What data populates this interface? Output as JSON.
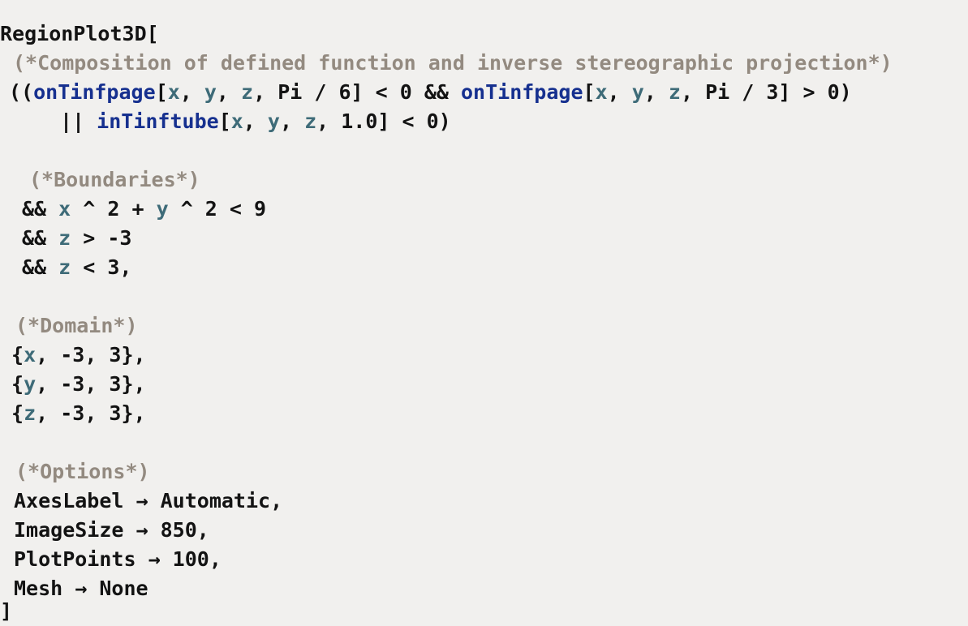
{
  "document": {
    "kind": "wolfram-language-code-listing",
    "background_color": "#f1f0ee",
    "colors": {
      "background": "#f1f0ee",
      "symbol": "#131313",
      "user_function": "#16308f",
      "local_variable": "#3e6b78",
      "comment": "#938a80"
    }
  },
  "code": {
    "head": "RegionPlot3D",
    "open_bracket": "[",
    "close_bracket": "]",
    "comments": {
      "composition": "(*Composition of defined function and inverse stereographic projection*)",
      "boundaries": "(*Boundaries*)",
      "domain": "(*Domain*)",
      "options": "(*Options*)"
    },
    "condition": {
      "line1": {
        "open": "((",
        "fn1": "onTinfpage",
        "args1_open": "[",
        "v1": "x",
        "c1": ", ",
        "v2": "y",
        "c2": ", ",
        "v3": "z",
        "c3": ", ",
        "pi1": "Pi / 6",
        "args1_close": "]",
        "cmp1": " < 0 && ",
        "fn2": "onTinfpage",
        "args2_open": "[",
        "v4": "x",
        "c4": ", ",
        "v5": "y",
        "c5": ", ",
        "v6": "z",
        "c6": ", ",
        "pi2": "Pi / 3",
        "args2_close": "]",
        "cmp2": " > 0)"
      },
      "line2": {
        "or_op": "|| ",
        "fn": "inTinftube",
        "args_open": "[",
        "v1": "x",
        "c1": ", ",
        "v2": "y",
        "c2": ", ",
        "v3": "z",
        "c3": ", ",
        "num": "1.0",
        "args_close": "]",
        "cmp": " < 0)"
      }
    },
    "boundaries": [
      {
        "op": "&& ",
        "v1": "x",
        "pow1": " ^ 2 + ",
        "v2": "y",
        "pow2": " ^ 2 < 9"
      },
      {
        "op": "&& ",
        "v1": "z",
        "rest": " > -3"
      },
      {
        "op": "&& ",
        "v1": "z",
        "rest": " < 3,"
      }
    ],
    "domain": [
      {
        "open": "{",
        "var": "x",
        "range": ", -3, 3},"
      },
      {
        "open": "{",
        "var": "y",
        "range": ", -3, 3},"
      },
      {
        "open": "{",
        "var": "z",
        "range": ", -3, 3},"
      }
    ],
    "options": [
      {
        "name": "AxesLabel",
        "arrow": " → ",
        "value": "Automatic,"
      },
      {
        "name": "ImageSize",
        "arrow": " → ",
        "value": "850,"
      },
      {
        "name": "PlotPoints",
        "arrow": " → ",
        "value": "100,"
      },
      {
        "name": "Mesh",
        "arrow": " → ",
        "value": "None"
      }
    ]
  }
}
